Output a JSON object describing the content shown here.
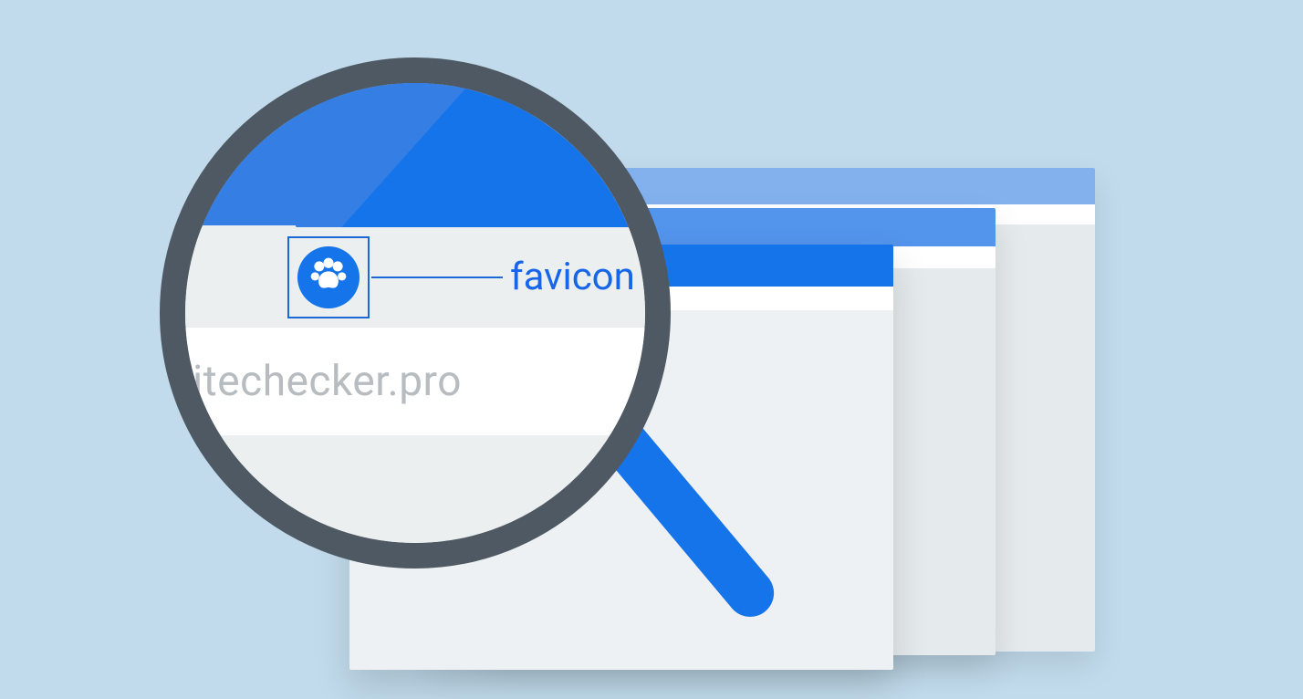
{
  "annotation": {
    "label": "favicon"
  },
  "address_bar": {
    "visible_text": "itechecker.pro"
  },
  "favicon": {
    "icon_name": "paw-icon",
    "bg_color": "#1674ea",
    "fg_color": "#ffffff"
  },
  "colors": {
    "background": "#c1dbec",
    "window_title_front": "#1674ea",
    "window_title_mid": "#5394ec",
    "window_title_back": "#83b1ee",
    "window_body": "#eef1f3",
    "lens_ring": "#4e5963",
    "handle": "#1674ea",
    "annotation": "#1b69d8",
    "addr_placeholder": "#b7bcc0"
  }
}
